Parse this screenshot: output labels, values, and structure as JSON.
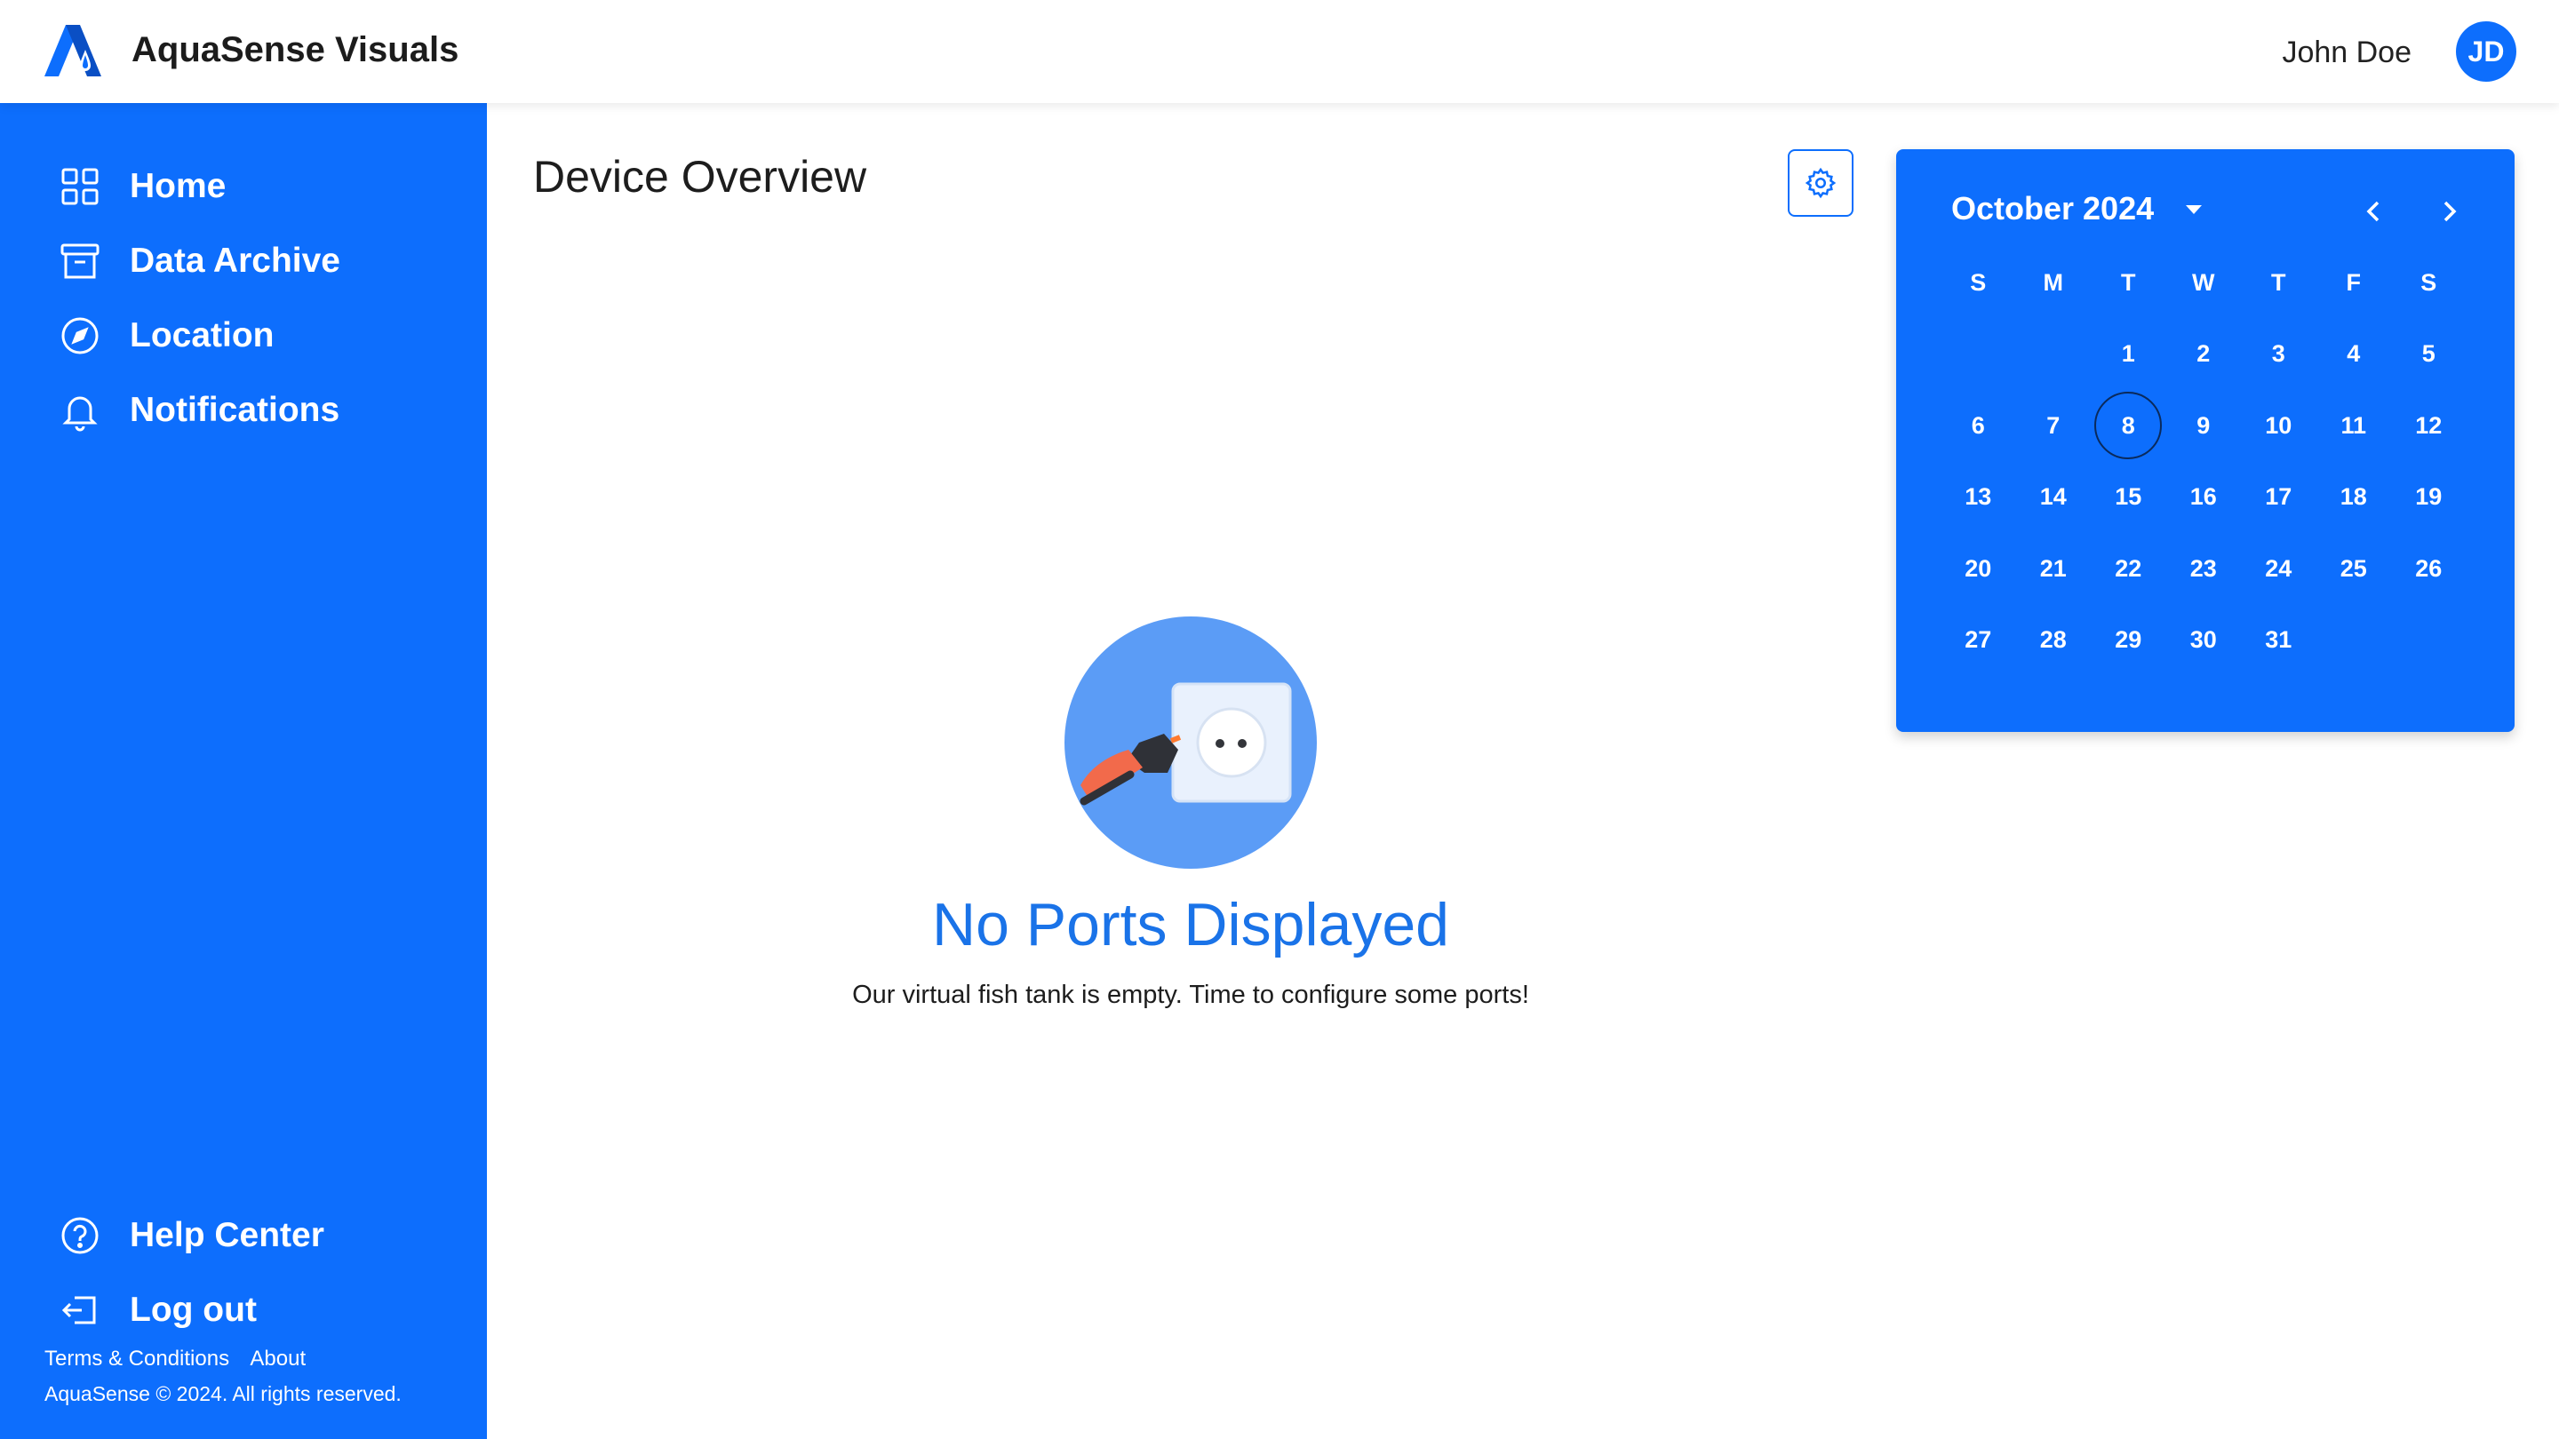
{
  "app": {
    "title": "AquaSense Visuals"
  },
  "user": {
    "name": "John Doe",
    "initials": "JD"
  },
  "sidebar": {
    "items": [
      {
        "label": "Home",
        "icon": "grid-icon"
      },
      {
        "label": "Data Archive",
        "icon": "archive-icon"
      },
      {
        "label": "Location",
        "icon": "compass-icon"
      },
      {
        "label": "Notifications",
        "icon": "bell-icon"
      }
    ],
    "bottom_items": [
      {
        "label": "Help Center",
        "icon": "help-icon"
      },
      {
        "label": "Log out",
        "icon": "logout-icon"
      }
    ],
    "footer": {
      "terms": "Terms & Conditions",
      "about": "About",
      "copyright": "AquaSense © 2024. All rights reserved."
    }
  },
  "main": {
    "title": "Device Overview",
    "empty_state": {
      "title": "No Ports Displayed",
      "subtitle": "Our virtual fish tank is empty. Time to configure some ports!"
    }
  },
  "calendar": {
    "month_label": "October 2024",
    "weekdays": [
      "S",
      "M",
      "T",
      "W",
      "T",
      "F",
      "S"
    ],
    "leading_blanks": 2,
    "days_in_month": 31,
    "selected_day": 8
  },
  "colors": {
    "primary": "#0d6efd",
    "accent_text": "#1a73e8"
  }
}
